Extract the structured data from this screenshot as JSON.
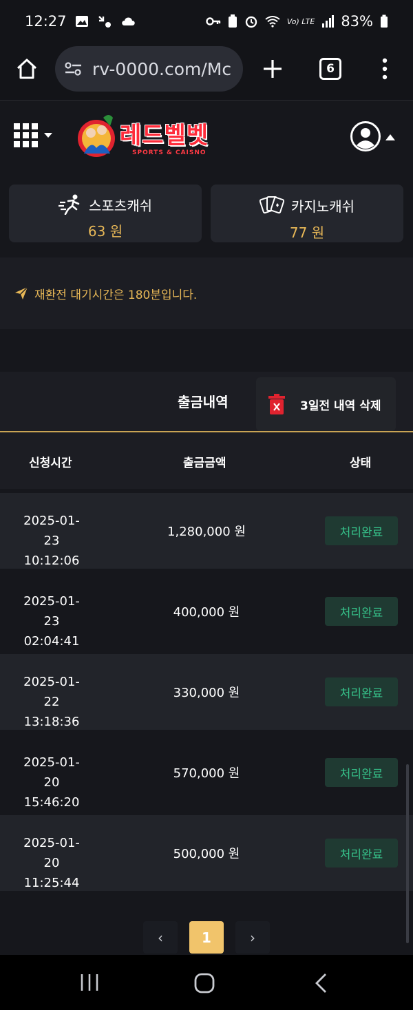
{
  "status_bar": {
    "time": "12:27",
    "battery": "83%",
    "network": "Vo) LTE"
  },
  "browser": {
    "url": "rv-0000.com/Mc",
    "tab_count": "6"
  },
  "site": {
    "logo_text": "레드벨벳",
    "logo_sub": "SPORTS & CAISNO"
  },
  "cash": [
    {
      "title": "스포츠캐쉬",
      "amount": "63 원",
      "icon": "running-icon"
    },
    {
      "title": "카지노캐쉬",
      "amount": "77 원",
      "icon": "cards-icon"
    }
  ],
  "notice": "재환전 대기시간은 180분입니다.",
  "history": {
    "title": "출금내역",
    "delete_label": "3일전 내역 삭제",
    "columns": [
      "신청시간",
      "출금금액",
      "상태"
    ],
    "rows": [
      {
        "date": "2025-01-23",
        "time": "10:12:06",
        "amount": "1,280,000 원",
        "status": "처리완료"
      },
      {
        "date": "2025-01-23",
        "time": "02:04:41",
        "amount": "400,000 원",
        "status": "처리완료"
      },
      {
        "date": "2025-01-22",
        "time": "13:18:36",
        "amount": "330,000 원",
        "status": "처리완료"
      },
      {
        "date": "2025-01-20",
        "time": "15:46:20",
        "amount": "570,000 원",
        "status": "처리완료"
      },
      {
        "date": "2025-01-20",
        "time": "11:25:44",
        "amount": "500,000 원",
        "status": "처리완료"
      }
    ]
  },
  "pager": {
    "prev": "‹",
    "current": "1",
    "next": "›"
  },
  "colors": {
    "accent_gold": "#e8b857",
    "status_green": "#36c28a",
    "page_active": "#f1c46b",
    "logo_red": "#e0232f"
  }
}
